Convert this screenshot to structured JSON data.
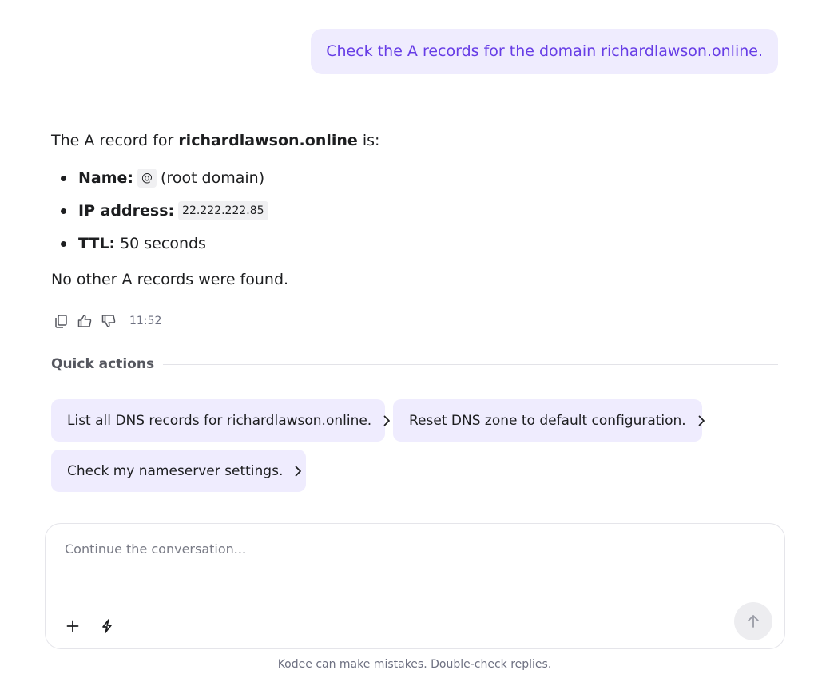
{
  "user_message": "Check the A records for the domain richardlawson.online.",
  "response": {
    "intro_prefix": "The A record for ",
    "intro_domain": "richardlawson.online",
    "intro_suffix": " is:",
    "bullets": [
      {
        "label": "Name:",
        "code": "@",
        "text": "(root domain)"
      },
      {
        "label": "IP address:",
        "code": "22.222.222.85",
        "text": ""
      },
      {
        "label": "TTL:",
        "code": "",
        "text": "50 seconds"
      }
    ],
    "outro": "No other A records were found.",
    "timestamp": "11:52",
    "icons": [
      "copy-icon",
      "thumbs-up-icon",
      "thumbs-down-icon"
    ]
  },
  "quick_actions": {
    "title": "Quick actions",
    "items": [
      "List all DNS records for richardlawson.online.",
      "Reset DNS zone to default configuration.",
      "Check my nameserver settings."
    ]
  },
  "composer": {
    "placeholder": "Continue the conversation...",
    "icons": [
      "plus-icon",
      "lightning-icon",
      "arrow-up-icon"
    ]
  },
  "disclaimer": "Kodee can make mistakes. Double-check replies.",
  "colors": {
    "accent": "#673de6",
    "bubble_bg": "#efecfe",
    "text": "#1d1e20",
    "muted": "#6d7081"
  }
}
